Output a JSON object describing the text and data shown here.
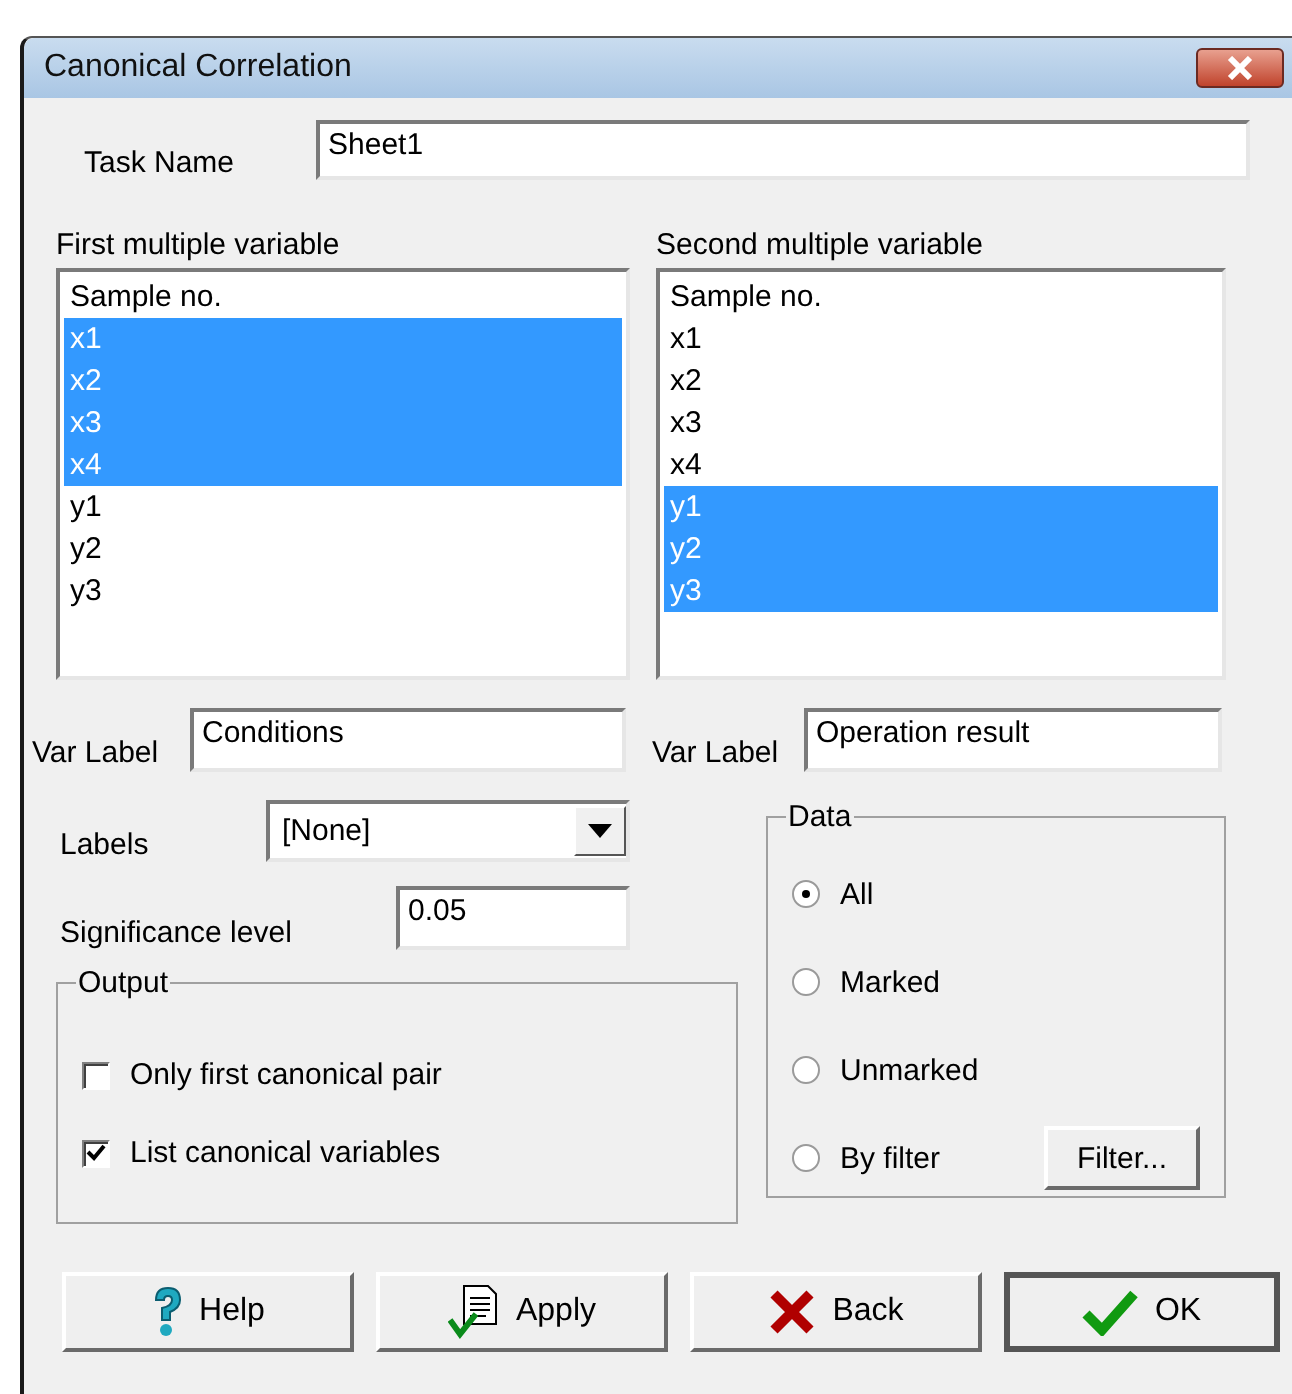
{
  "window": {
    "title": "Canonical Correlation"
  },
  "task_name": {
    "label": "Task Name",
    "value": "Sheet1"
  },
  "lists": [
    {
      "label": "First multiple variable",
      "items": [
        {
          "text": "Sample no.",
          "selected": false
        },
        {
          "text": "x1",
          "selected": true
        },
        {
          "text": "x2",
          "selected": true
        },
        {
          "text": "x3",
          "selected": true
        },
        {
          "text": "x4",
          "selected": true
        },
        {
          "text": "y1",
          "selected": false
        },
        {
          "text": "y2",
          "selected": false
        },
        {
          "text": "y3",
          "selected": false
        }
      ],
      "var_label": {
        "label": "Var Label",
        "value": "Conditions"
      }
    },
    {
      "label": "Second multiple variable",
      "items": [
        {
          "text": "Sample no.",
          "selected": false
        },
        {
          "text": "x1",
          "selected": false
        },
        {
          "text": "x2",
          "selected": false
        },
        {
          "text": "x3",
          "selected": false
        },
        {
          "text": "x4",
          "selected": false
        },
        {
          "text": "y1",
          "selected": true
        },
        {
          "text": "y2",
          "selected": true
        },
        {
          "text": "y3",
          "selected": true
        }
      ],
      "var_label": {
        "label": "Var Label",
        "value": "Operation result"
      }
    }
  ],
  "labels": {
    "label": "Labels",
    "value": "[None]"
  },
  "significance": {
    "label": "Significance level",
    "value": "0.05"
  },
  "output": {
    "title": "Output",
    "options": [
      {
        "label": "Only first canonical pair",
        "checked": false
      },
      {
        "label": "List canonical variables",
        "checked": true
      }
    ]
  },
  "data": {
    "title": "Data",
    "options": [
      {
        "label": "All",
        "selected": true
      },
      {
        "label": "Marked",
        "selected": false
      },
      {
        "label": "Unmarked",
        "selected": false
      },
      {
        "label": "By filter",
        "selected": false
      }
    ],
    "filter_button": "Filter..."
  },
  "buttons": [
    {
      "label": "Help",
      "kind": "help",
      "default": false
    },
    {
      "label": "Apply",
      "kind": "apply",
      "default": false
    },
    {
      "label": "Back",
      "kind": "back",
      "default": false
    },
    {
      "label": "OK",
      "kind": "ok",
      "default": true
    }
  ]
}
